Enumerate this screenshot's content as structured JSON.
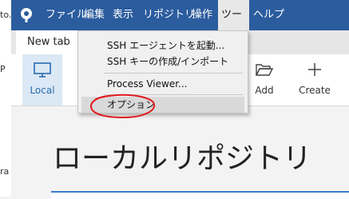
{
  "left_edge_fragments": [
    "to.",
    "P",
    "ra"
  ],
  "menubar": {
    "items": [
      {
        "label": "ファイル"
      },
      {
        "label": "編集"
      },
      {
        "label": "表示"
      },
      {
        "label": "リポジトリ"
      },
      {
        "label": "操作"
      },
      {
        "label": "ツール"
      },
      {
        "label": "ヘルプ"
      }
    ]
  },
  "tab": {
    "label": "New tab"
  },
  "toolbar": {
    "local_label": "Local",
    "add_label": "Add",
    "create_label": "Create"
  },
  "tools_menu": {
    "items": [
      {
        "label": "SSH エージェントを起動..."
      },
      {
        "label": "SSH キーの作成/インポート"
      },
      {
        "label": "Process Viewer..."
      },
      {
        "label": "オプション"
      }
    ]
  },
  "content": {
    "title": "ローカルリポジトリ"
  },
  "colors": {
    "accent": "#2b5c9e",
    "annotation": "#e0191f"
  }
}
